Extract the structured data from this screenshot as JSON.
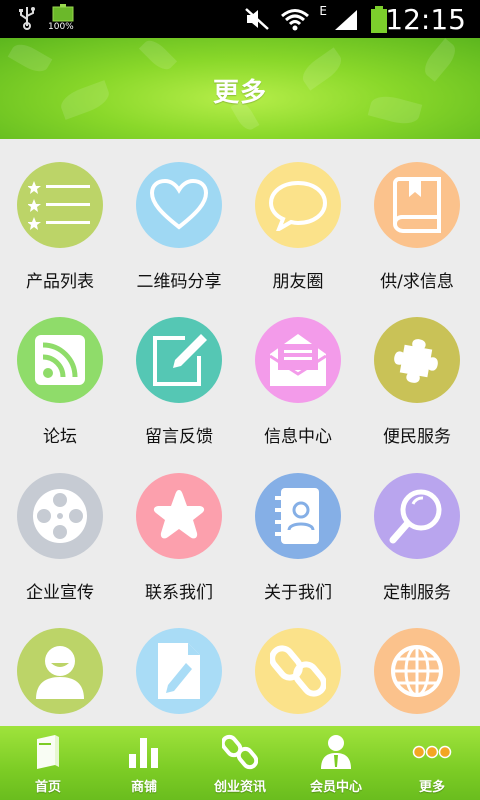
{
  "status_bar": {
    "battery_small_label": "100%",
    "network_type": "E",
    "time": "12:15"
  },
  "header": {
    "title": "更多"
  },
  "grid_items": [
    {
      "label": "产品列表",
      "icon": "list-stars-icon",
      "color": "#bcd468"
    },
    {
      "label": "二维码分享",
      "icon": "heart-icon",
      "color": "#9fd8f3"
    },
    {
      "label": "朋友圈",
      "icon": "chat-bubble-icon",
      "color": "#fbe28a"
    },
    {
      "label": "供/求信息",
      "icon": "book-icon",
      "color": "#fbc28c"
    },
    {
      "label": "论坛",
      "icon": "rss-icon",
      "color": "#8fdc6a"
    },
    {
      "label": "留言反馈",
      "icon": "edit-icon",
      "color": "#55c7b4"
    },
    {
      "label": "信息中心",
      "icon": "envelope-icon",
      "color": "#f39bea"
    },
    {
      "label": "便民服务",
      "icon": "puzzle-icon",
      "color": "#c9c257"
    },
    {
      "label": "企业宣传",
      "icon": "film-reel-icon",
      "color": "#c6cbd3"
    },
    {
      "label": "联系我们",
      "icon": "star-icon",
      "color": "#fca0ad"
    },
    {
      "label": "关于我们",
      "icon": "contacts-book-icon",
      "color": "#85afe6"
    },
    {
      "label": "定制服务",
      "icon": "magnifier-icon",
      "color": "#b9a5ee"
    },
    {
      "label": "",
      "icon": "user-icon",
      "color": "#bcd468"
    },
    {
      "label": "",
      "icon": "document-edit-icon",
      "color": "#a9dcf6"
    },
    {
      "label": "",
      "icon": "chain-link-icon",
      "color": "#fbe28a"
    },
    {
      "label": "",
      "icon": "globe-icon",
      "color": "#fbc28c"
    }
  ],
  "bottom_nav": [
    {
      "label": "首页",
      "icon": "book-home-icon"
    },
    {
      "label": "商铺",
      "icon": "bar-chart-icon"
    },
    {
      "label": "创业资讯",
      "icon": "chain-link-icon"
    },
    {
      "label": "会员中心",
      "icon": "member-icon"
    },
    {
      "label": "更多",
      "icon": "more-dots-icon"
    }
  ]
}
